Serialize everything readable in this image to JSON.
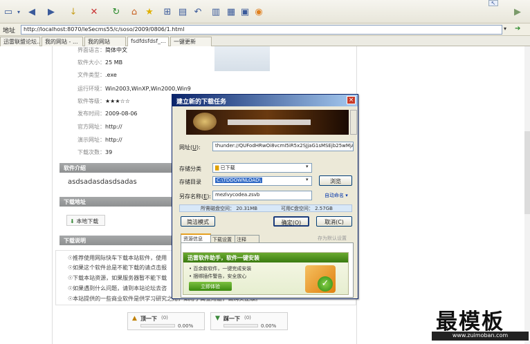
{
  "browser": {
    "address_label": "地址",
    "url": "http://localhost:8070/leSecms55/c/soso/2009/0806/1.html",
    "tabs": [
      "迅雷联盟论坛...",
      "我的网站 - ...",
      "我的网站",
      "fsdfdsfdsf_...",
      "一键更新"
    ]
  },
  "info": {
    "lang": {
      "label": "界面语言：",
      "value": "简体中文"
    },
    "size": {
      "label": "软件大小：",
      "value": "25 MB"
    },
    "type": {
      "label": "文件类型：",
      "value": ".exe"
    },
    "env": {
      "label": "运行环境：",
      "value": "Win2003,WinXP,Win2000,Win9"
    },
    "rating": {
      "label": "软件等级：",
      "value": "★★★☆☆"
    },
    "date": {
      "label": "发布时间：",
      "value": "2009-08-06"
    },
    "site": {
      "label": "官方网址：",
      "value": "http://"
    },
    "demo": {
      "label": "演示网址：",
      "value": "http://"
    },
    "downloads": {
      "label": "下载次数：",
      "value": "39"
    }
  },
  "sections": {
    "intro": "软件介绍",
    "intro_text": "asdsadasdasdsadas",
    "download": "下载地址",
    "download_btn": "本地下载",
    "notes": "下载说明"
  },
  "notes": [
    "☉推荐使用网际快车下载本站软件，使用",
    "☉如果这个软件总是不能下载的请点击报",
    "☉下载本站资源，如果服务器暂不能下载",
    "☉如果遇到什么问题，请到本站论坛去咨",
    "☉本站提供的一些商业软件是供学习研究之用，如用于商业用途，请购买正版。"
  ],
  "dialog": {
    "title": "建立新的下载任务",
    "close": "×",
    "url_label": "网址(",
    "url_label_key": "U",
    "url_label_end": "):",
    "url_value": "thunder://QUFodHRwOi8vcmI5iR5x2SJjaG1sMSEjb25wMjAxOOEzL",
    "category_label": "存储分类",
    "category_value": "已下载",
    "dir_label": "存储目录",
    "dir_value": "C:\\TDDOWNLOAD\\",
    "browse": "浏览",
    "save_as_label": "另存名称(",
    "save_as_key": "E",
    "save_as_end": "):",
    "save_as_value": "mezlvycodea.zsvb",
    "auto_name": "自动命名",
    "disk_space": "所需磁盘空间： 20.31MB",
    "free_space": "可用C盘空间： 2.57GB",
    "simple_mode": "简洁模式",
    "ok": "确定(O)",
    "cancel": "取消(C)",
    "tabs": [
      "资源信息",
      "下载设置",
      "注释（空）"
    ],
    "set_default": "存为默认设置",
    "promo_title": "迅雷软件助手，软件一键安装",
    "promo_items": [
      "• 百余款软件，一键完成安装",
      "• 捆绑插件警告，安全放心"
    ],
    "promo_btn": "立即体验"
  },
  "votes": {
    "up_label": "顶一下",
    "up_count": "(0)",
    "up_pct": "0.00%",
    "down_label": "踩一下",
    "down_count": "(0)",
    "down_pct": "0.00%"
  },
  "watermark": {
    "title": "最模板",
    "url": "www.zuimoban.com"
  },
  "colors": {
    "title_bar": "#0a246a",
    "section_bg": "#999b9c",
    "selection": "#316ac5"
  }
}
